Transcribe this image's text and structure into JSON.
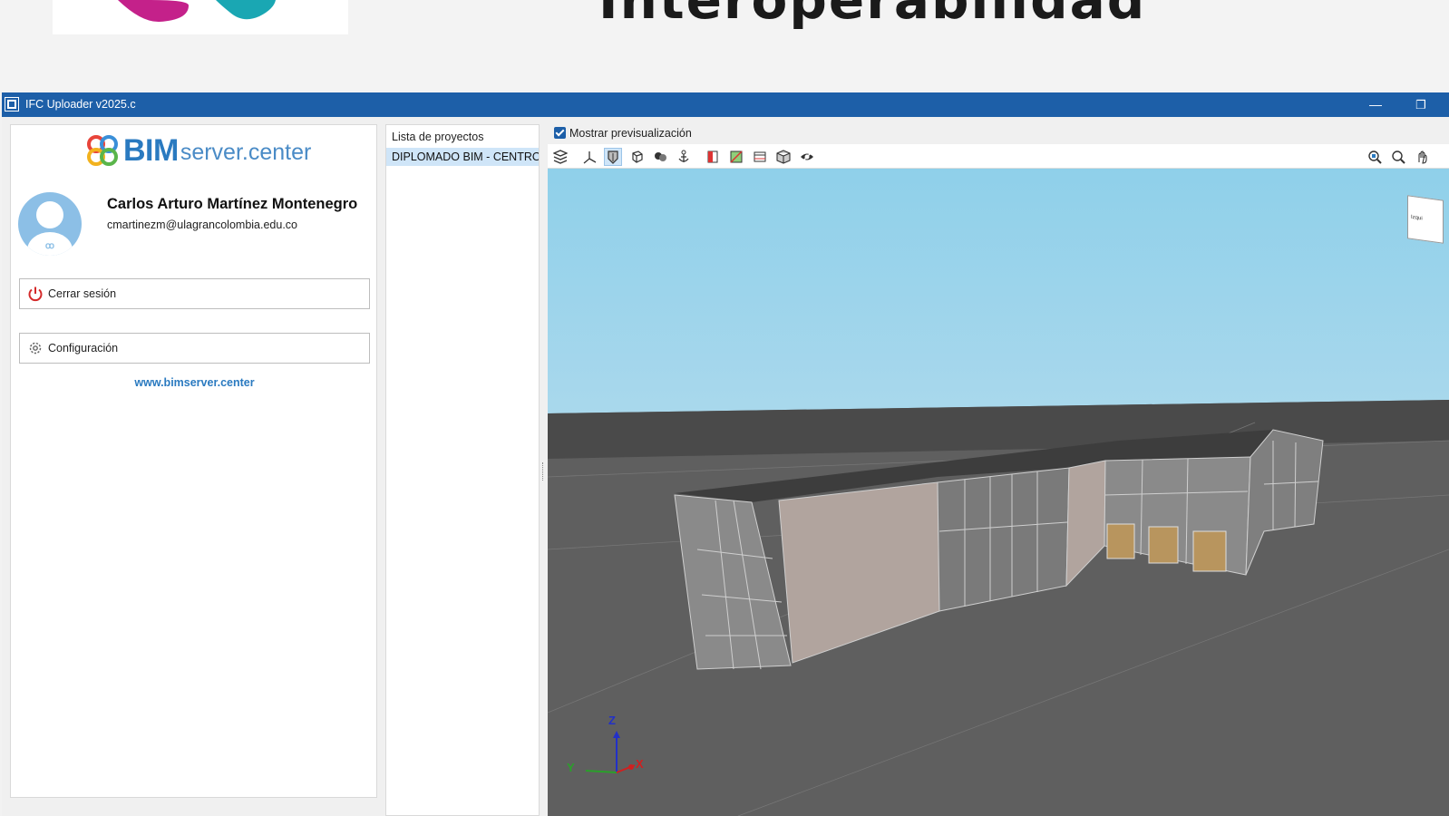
{
  "slide": {
    "title": "Interoperabilidad",
    "registered_mark": "®"
  },
  "window": {
    "title": "IFC Uploader v2025.c",
    "minimize_glyph": "—",
    "maximize_glyph": "❐"
  },
  "account": {
    "logo_brand": "BIM",
    "logo_suffix": "server.center",
    "user_name": "Carlos Arturo Martínez Montenegro",
    "user_email": "cmartinezm@ulagrancolombia.edu.co",
    "logout_label": "Cerrar sesión",
    "settings_label": "Configuración",
    "website_link": "www.bimserver.center"
  },
  "projects": {
    "header": "Lista de proyectos",
    "items": [
      {
        "label": "DIPLOMADO BIM - CENTRO",
        "selected": true
      }
    ]
  },
  "preview": {
    "show_preview_label": "Mostrar previsualización",
    "show_preview_checked": true,
    "toolbar_left": [
      "layers-icon",
      "axes-icon",
      "shaded-view-icon",
      "wireframe-icon",
      "hide-elements-icon",
      "anchor-icon",
      "section-box-icon",
      "clip-plane-icon",
      "floor-plan-icon",
      "3d-box-icon",
      "visibility-icon"
    ],
    "toolbar_right": [
      "zoom-extents-icon",
      "zoom-icon",
      "pan-icon"
    ],
    "view_cube_label": "Izqui",
    "axes": {
      "z": "Z",
      "y": "Y",
      "x": "X"
    }
  },
  "colors": {
    "titlebar": "#1d5fa8",
    "accent": "#2a7ac0",
    "sky": "#8fd0ea",
    "ground": "#5f5f5f",
    "selection": "#cfe5f8"
  }
}
